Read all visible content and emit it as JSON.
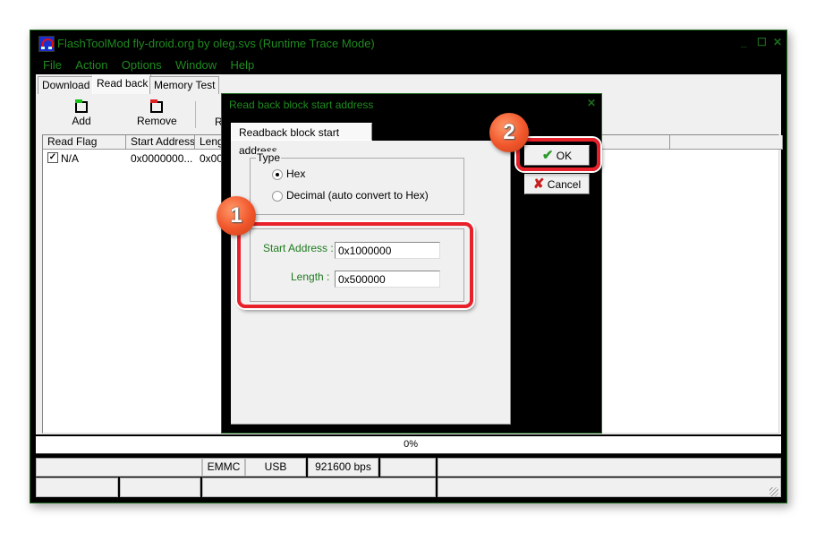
{
  "window": {
    "title": "FlashToolMod fly-droid.org by oleg.svs (Runtime Trace Mode)",
    "controls": {
      "minimize": "_",
      "maximize": "☐",
      "close": "✕"
    }
  },
  "menu": [
    "File",
    "Action",
    "Options",
    "Window",
    "Help"
  ],
  "tabs": [
    {
      "label": "Download",
      "active": false
    },
    {
      "label": "Read back",
      "active": true
    },
    {
      "label": "Memory Test",
      "active": false
    }
  ],
  "toolbar": {
    "add_label": "Add",
    "remove_label": "Remove",
    "partial_label": "R"
  },
  "list": {
    "columns": [
      "Read Flag",
      "Start Address",
      "Leng"
    ],
    "rows": [
      {
        "checked": true,
        "read_flag": "N/A",
        "start_address": "0x0000000...",
        "length": "0x00"
      }
    ]
  },
  "progress": {
    "text": "0%",
    "value_percent": 0
  },
  "status": {
    "storage": "EMMC",
    "connection": "USB",
    "baud": "921600 bps"
  },
  "dialog": {
    "title": "Read back block start address",
    "close": "✕",
    "tab_label": "Readback block start address",
    "type_group_label": "Type",
    "radio_hex": "Hex",
    "radio_decimal": "Decimal (auto convert to Hex)",
    "selected_type": "Hex",
    "start_address_label": "Start Address :",
    "start_address_value": "0x1000000",
    "length_label": "Length :",
    "length_value": "0x500000",
    "ok_label": "OK",
    "cancel_label": "Cancel"
  },
  "annotations": {
    "badge_1": "1",
    "badge_2": "2",
    "highlight_color": "#e8202a",
    "badge_color": "#f0552a"
  }
}
